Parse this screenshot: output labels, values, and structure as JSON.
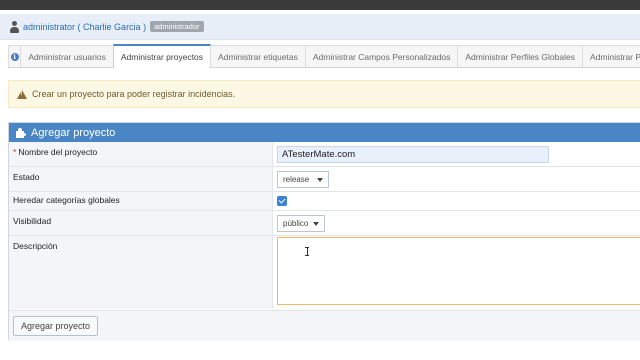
{
  "user": {
    "username": "administrator",
    "realname": "( Charlie Garcia )",
    "role": "administrador"
  },
  "tabs": [
    {
      "label": "Administrar usuarios"
    },
    {
      "label": "Administrar proyectos"
    },
    {
      "label": "Administrar etiquetas"
    },
    {
      "label": "Administrar Campos Personalizados"
    },
    {
      "label": "Administrar Perfiles Globales"
    },
    {
      "label": "Administrar P"
    }
  ],
  "alert": {
    "message": "Crear un proyecto para poder registrar incidencias."
  },
  "form": {
    "title": "Agregar proyecto",
    "required_mark": "*",
    "name_label": "Nombre del proyecto",
    "name_value": "ATesterMate.com",
    "status_label": "Estado",
    "status_value": "release",
    "inherit_label": "Heredar categorías globales",
    "inherit_checked": true,
    "visibility_label": "Visibilidad",
    "visibility_value": "público",
    "description_label": "Descripción",
    "description_value": "",
    "submit_label": "Agregar proyecto"
  },
  "colors": {
    "accent": "#4a86c5",
    "alert_bg": "#fcf8e3",
    "required": "#c0392b"
  }
}
